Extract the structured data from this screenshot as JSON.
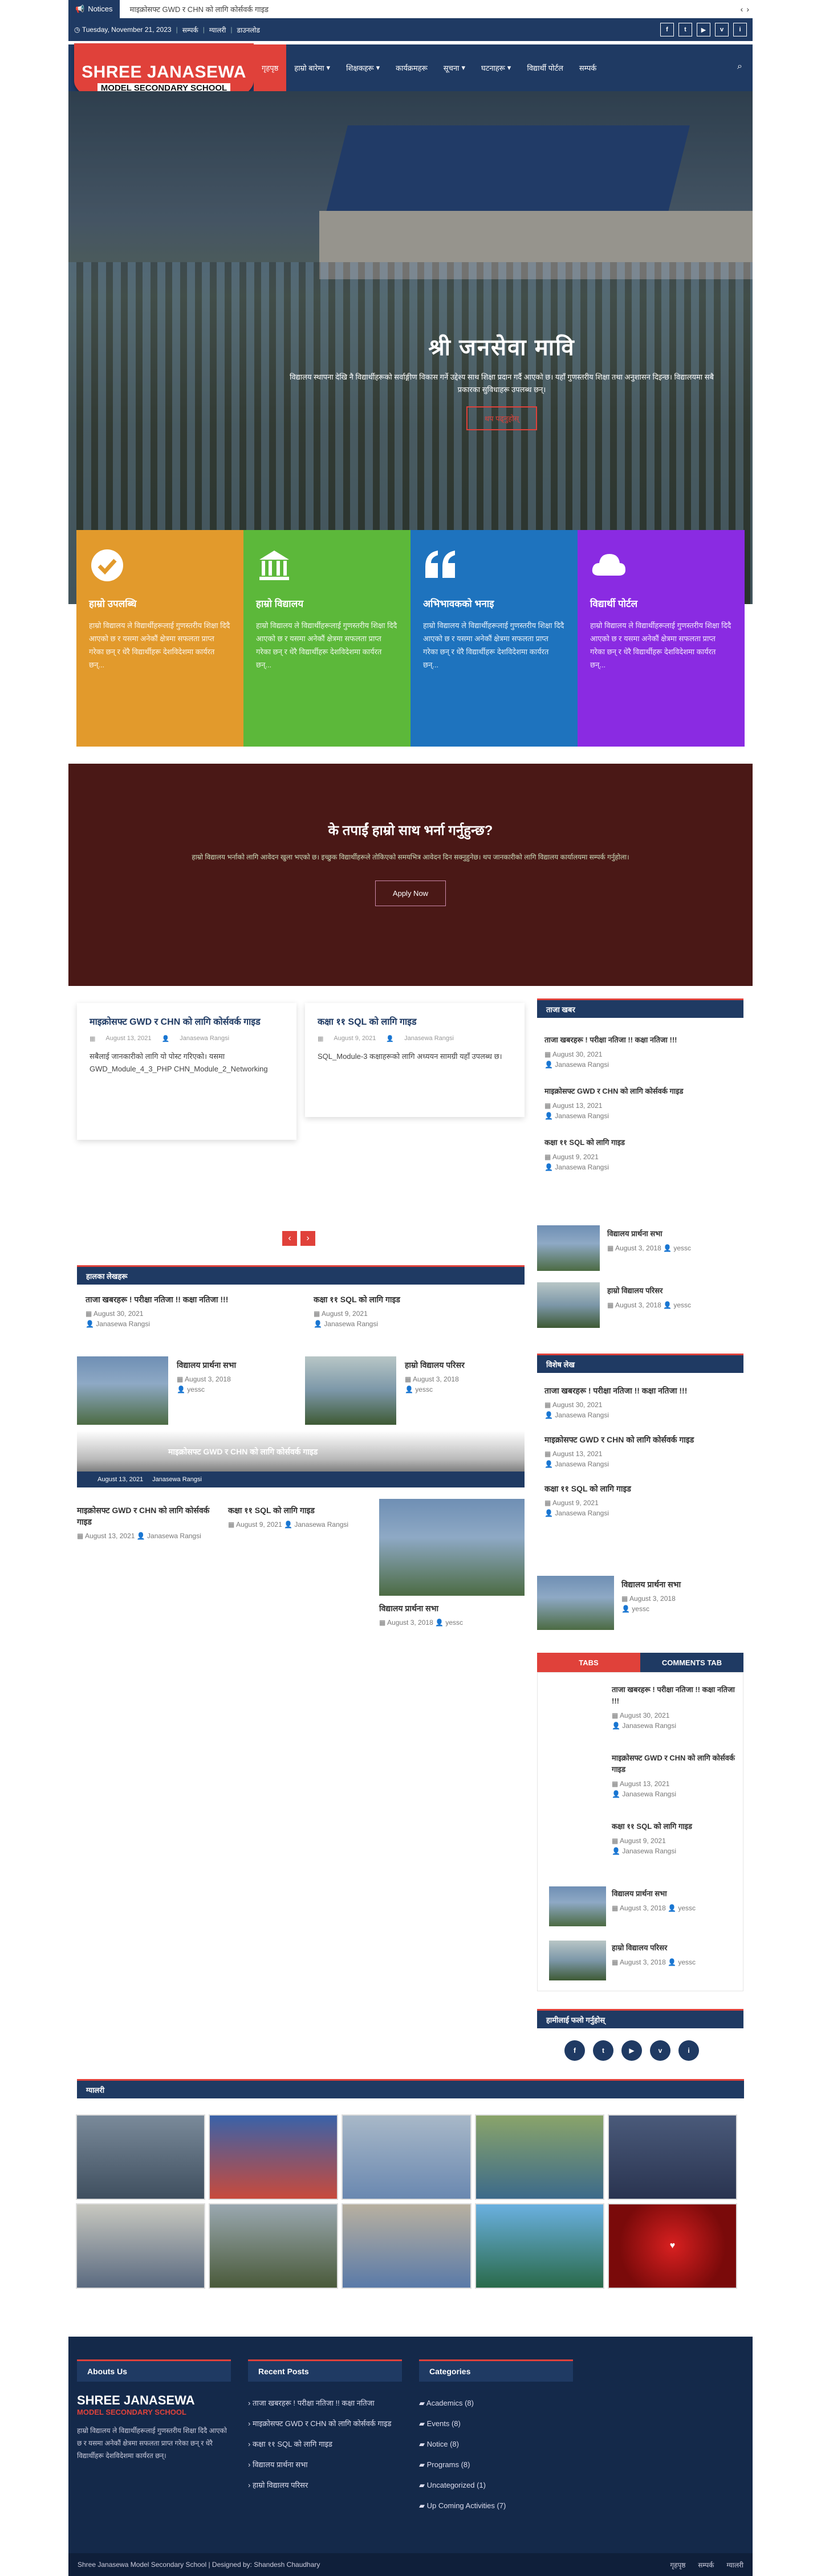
{
  "notice": {
    "label": "Notices",
    "text": "माइक्रोसफ्ट GWD र CHN को लागि कोर्सवर्क गाइड"
  },
  "info": {
    "date": "Tuesday, November 21, 2023",
    "links": [
      "सम्पर्क",
      "ग्यालरी",
      "डाउनलोड"
    ]
  },
  "socials": [
    "f",
    "t",
    "▶",
    "v",
    "i"
  ],
  "logo": {
    "line1": "SHREE JANASEWA",
    "line2": "MODEL SECONDARY SCHOOL"
  },
  "menu": [
    "गृहपृष्ठ",
    "हाम्रो बारेमा",
    "शिक्षकहरू",
    "कार्यक्रमहरू",
    "सूचना",
    "घटनाहरू",
    "विद्यार्थी पोर्टल",
    "सम्पर्क"
  ],
  "hero": {
    "title": "श्री जनसेवा मावि",
    "text": "विद्यालय स्थापना देखि नै विद्यार्थीहरूको सर्वाङ्गीण विकास गर्ने उद्देश्य साथ शिक्षा प्रदान गर्दै आएको छ। यहाँ गुणस्तरीय शिक्षा तथा अनुशासन दिइन्छ। विद्यालयमा सबै प्रकारका सुविधाहरू उपलब्ध छन्।",
    "button": "थप पढ्नुहोस्"
  },
  "features": [
    {
      "title": "हाम्रो उपलब्धि",
      "text": "हाम्रो विद्यालय ले विद्यार्थीहरूलाई गुणस्तरीय शिक्षा दिदै आएको छ र यसमा अनेकौं क्षेत्रमा सफलता प्राप्त गरेका छन् र धेरै विद्यार्थीहरू देशविदेशमा कार्यरत छन्...",
      "color": "#e29a2c",
      "icon": "check-circle-icon"
    },
    {
      "title": "हाम्रो विद्यालय",
      "text": "हाम्रो विद्यालय ले विद्यार्थीहरूलाई गुणस्तरीय शिक्षा दिदै आएको छ र यसमा अनेकौं क्षेत्रमा सफलता प्राप्त गरेका छन् र धेरै विद्यार्थीहरू देशविदेशमा कार्यरत छन्...",
      "color": "#5cb83a",
      "icon": "institution-icon"
    },
    {
      "title": "अभिभावकको भनाइ",
      "text": "हाम्रो विद्यालय ले विद्यार्थीहरूलाई गुणस्तरीय शिक्षा दिदै आएको छ र यसमा अनेकौं क्षेत्रमा सफलता प्राप्त गरेका छन् र धेरै विद्यार्थीहरू देशविदेशमा कार्यरत छन्...",
      "color": "#1e73be",
      "icon": "quote-icon"
    },
    {
      "title": "विद्यार्थी पोर्टल",
      "text": "हाम्रो विद्यालय ले विद्यार्थीहरूलाई गुणस्तरीय शिक्षा दिदै आएको छ र यसमा अनेकौं क्षेत्रमा सफलता प्राप्त गरेका छन् र धेरै विद्यार्थीहरू देशविदेशमा कार्यरत छन्...",
      "color": "#8a2be2",
      "icon": "cloud-icon"
    }
  ],
  "apply": {
    "title": "के तपाईं हाम्रो साथ भर्ना गर्नुहुन्छ?",
    "text": "हाम्रो विद्यालय भर्नाको लागि आवेदन खुला भएको छ। इच्छुक विद्यार्थीहरूले तोकिएको समयभित्र आवेदन दिन सक्नुहुनेछ। थप जानकारीको लागि विद्यालय कार्यालयमा सम्पर्क गर्नुहोला।",
    "button": "Apply Now"
  },
  "cards": [
    {
      "title": "माइक्रोसफ्ट GWD र CHN को लागि कोर्सवर्क गाइड",
      "date": "August 13, 2021",
      "author": "Janasewa Rangsi",
      "text": "सबैलाई जानकारीको लागि यो पोस्ट गरिएको। यसमा GWD_Module_4_3_PHP CHN_Module_2_Networking"
    },
    {
      "title": "कक्षा ११ SQL को लागि गाइड",
      "date": "August 9, 2021",
      "author": "Janasewa Rangsi",
      "text": "SQL_Module-3 कक्षाहरूको लागि अध्ययन सामग्री यहाँ उपलब्ध छ।"
    }
  ],
  "recent_head": "हालका लेखहरू",
  "recent_posts": [
    {
      "title": "ताजा खबरहरू ! परीक्षा नतिजा !! कक्षा नतिजा !!!",
      "date": "August 30, 2021",
      "author": "Janasewa Rangsi"
    },
    {
      "title": "कक्षा ११ SQL को लागि गाइड",
      "date": "August 9, 2021",
      "author": "Janasewa Rangsi"
    },
    {
      "title": "विद्यालय प्रार्थना सभा",
      "date": "August 3, 2018",
      "author": "yessc"
    },
    {
      "title": "हाम्रो विद्यालय परिसर",
      "date": "August 3, 2018",
      "author": "yessc"
    },
    {
      "title": "माइक्रोसफ्ट GWD र CHN को लागि कोर्सवर्क गाइड",
      "date": "August 13, 2021",
      "author": "Janasewa Rangsi"
    },
    {
      "title": "कक्षा ११ SQL को लागि गाइड",
      "date": "August 9, 2021",
      "author": "Janasewa Rangsi"
    },
    {
      "title": "विद्यालय प्रार्थना सभा",
      "date": "August 3, 2018",
      "author": "yessc"
    }
  ],
  "slider_caption": "माइक्रोसफ्ट GWD र CHN को लागि कोर्सवर्क गाइड",
  "sidebar": {
    "latest_head": "ताजा खबर",
    "latest": [
      {
        "title": "ताजा खबरहरू ! परीक्षा नतिजा !! कक्षा नतिजा !!!",
        "date": "August 30, 2021",
        "author": "Janasewa Rangsi"
      },
      {
        "title": "माइक्रोसफ्ट GWD र CHN को लागि कोर्सवर्क गाइड",
        "date": "August 13, 2021",
        "author": "Janasewa Rangsi"
      },
      {
        "title": "कक्षा ११ SQL को लागि गाइड",
        "date": "August 9, 2021",
        "author": "Janasewa Rangsi"
      },
      {
        "title": "विद्यालय प्रार्थना सभा",
        "date": "August 3, 2018",
        "author": "yessc"
      },
      {
        "title": "हाम्रो विद्यालय परिसर",
        "date": "August 3, 2018",
        "author": "yessc"
      }
    ],
    "featured_head": "विशेष लेख",
    "featured": [
      {
        "title": "ताजा खबरहरू ! परीक्षा नतिजा !! कक्षा नतिजा !!!",
        "date": "August 30, 2021",
        "author": "Janasewa Rangsi"
      },
      {
        "title": "माइक्रोसफ्ट GWD र CHN को लागि कोर्सवर्क गाइड",
        "date": "August 13, 2021",
        "author": "Janasewa Rangsi"
      },
      {
        "title": "कक्षा ११ SQL को लागि गाइड",
        "date": "August 9, 2021",
        "author": "Janasewa Rangsi"
      },
      {
        "title": "विद्यालय प्रार्थना सभा",
        "date": "August 3, 2018",
        "author": "yessc"
      }
    ],
    "tab1": "TABS",
    "tab2": "COMMENTS TAB",
    "follow_head": "हामीलाई फलो गर्नुहोस्"
  },
  "gallery_head": "ग्यालरी",
  "footer": {
    "about_head": "Abouts Us",
    "about_logo1": "SHREE JANASEWA",
    "about_logo2": "MODEL SECONDARY SCHOOL",
    "about_text": "हाम्रो विद्यालय ले विद्यार्थीहरूलाई गुणस्तरीय शिक्षा दिदै आएको छ र यसमा अनेकौं क्षेत्रमा सफलता प्राप्त गरेका छन् र धेरै विद्यार्थीहरू देशविदेशमा कार्यरत छन्।",
    "recent_head": "Recent Posts",
    "recent": [
      "ताजा खबरहरू ! परीक्षा नतिजा !! कक्षा नतिजा",
      "माइक्रोसफ्ट GWD र CHN को लागि कोर्सवर्क गाइड",
      "कक्षा ११ SQL को लागि गाइड",
      "विद्यालय प्रार्थना सभा",
      "हाम्रो विद्यालय परिसर"
    ],
    "cat_head": "Categories",
    "cats": [
      "Academics (8)",
      "Events (8)",
      "Notice (8)",
      "Programs (8)",
      "Uncategorized (1)",
      "Up Coming Activities (7)"
    ]
  },
  "copyright": "Shree Janasewa Model Secondary School | Designed by: Shandesh Chaudhary",
  "copy_links": [
    "गृहपृष्ठ",
    "सम्पर्क",
    "ग्यालरी"
  ],
  "colors": {
    "brand": "#1f3a63",
    "accent": "#e0413a"
  }
}
